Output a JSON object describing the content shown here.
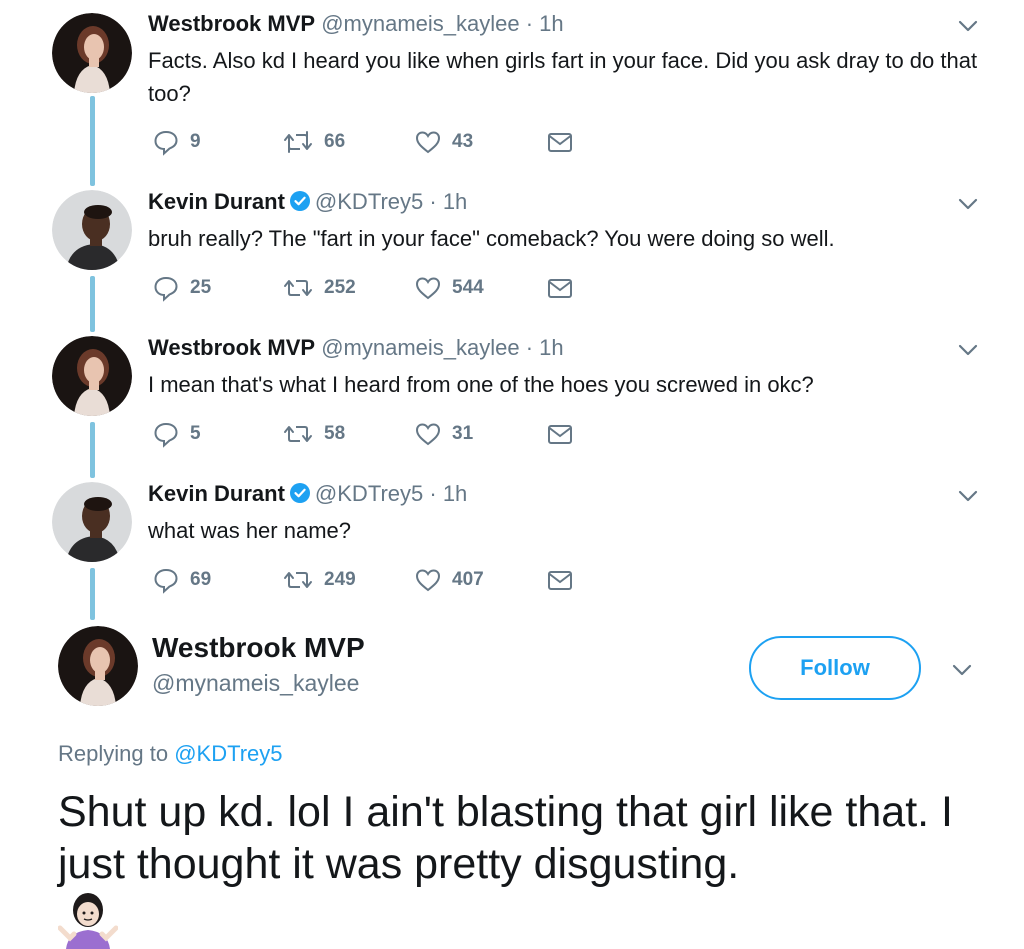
{
  "tweets": [
    {
      "name": "Westbrook MVP",
      "handle": "@mynameis_kaylee",
      "time": "· 1h",
      "verified": false,
      "avatar": "woman-avatar",
      "text": "Facts. Also kd I heard you like when girls fart in your face. Did you ask dray to do that too?",
      "replies": "9",
      "retweets": "66",
      "likes": "43"
    },
    {
      "name": "Kevin Durant",
      "handle": "@KDTrey5",
      "time": "· 1h",
      "verified": true,
      "avatar": "man-avatar",
      "text": "bruh really? The \"fart in your face\" comeback? You were doing so well.",
      "replies": "25",
      "retweets": "252",
      "likes": "544"
    },
    {
      "name": "Westbrook MVP",
      "handle": "@mynameis_kaylee",
      "time": "· 1h",
      "verified": false,
      "avatar": "woman-avatar",
      "text": "I mean that's what I heard from one of the hoes you screwed in okc?",
      "replies": "5",
      "retweets": "58",
      "likes": "31"
    },
    {
      "name": "Kevin Durant",
      "handle": "@KDTrey5",
      "time": "· 1h",
      "verified": true,
      "avatar": "man-avatar",
      "text": "what was her name?",
      "replies": "69",
      "retweets": "249",
      "likes": "407"
    }
  ],
  "main_tweet": {
    "name": "Westbrook MVP",
    "handle": "@mynameis_kaylee",
    "follow_label": "Follow",
    "replying_prefix": "Replying to",
    "replying_to": "@KDTrey5",
    "text": "Shut up kd. lol I ain't blasting that girl like that. I just thought it was pretty disgusting.",
    "emoji": "person-shrugging-emoji"
  },
  "colors": {
    "accent": "#1da1f2",
    "thread_line": "#7fc3df",
    "muted": "#657786",
    "text": "#14171a"
  }
}
